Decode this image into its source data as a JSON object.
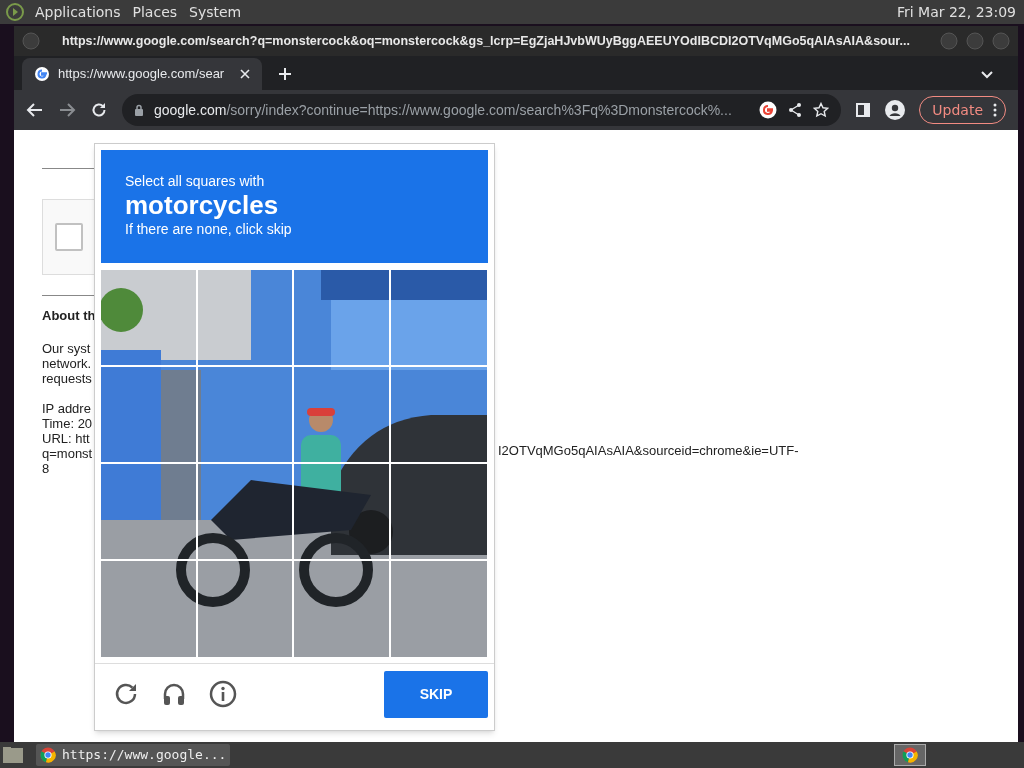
{
  "top_panel": {
    "menus": [
      "Applications",
      "Places",
      "System"
    ],
    "clock": "Fri Mar 22, 23:09"
  },
  "window": {
    "title": "https://www.google.com/search?q=monstercock&oq=monstercock&gs_lcrp=EgZjaHJvbWUyBggAEEUYOdIBCDI2OTVqMGo5qAIAsAIA&sour..."
  },
  "tabs": [
    {
      "label": "https://www.google.com/sear",
      "selected": true
    }
  ],
  "address_bar": {
    "host": "google.com",
    "path": "/sorry/index?continue=https://www.google.com/search%3Fq%3Dmonstercock%...",
    "update_button": "Update"
  },
  "page": {
    "checkbox": {
      "checked": false
    },
    "heading": "About th",
    "paragraph": [
      "Our syst",
      "network.",
      "requests"
    ],
    "details": [
      "IP addre",
      "Time: 20",
      "URL: htt",
      "q=monst",
      "8"
    ],
    "url_tail": "I2OTVqMGo5qAIAsAIA&sourceid=chrome&ie=UTF-"
  },
  "captcha": {
    "instruction": "Select all squares with",
    "target": "motorcycles",
    "hint": "If there are none, click skip",
    "skip_button": "SKIP"
  },
  "taskbar": {
    "items": [
      {
        "label": "https://www.google..."
      }
    ]
  }
}
